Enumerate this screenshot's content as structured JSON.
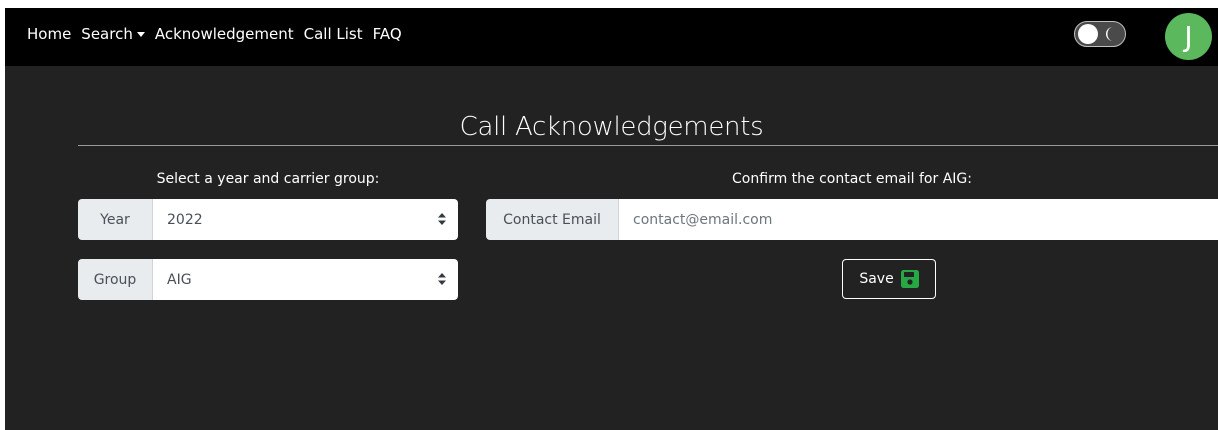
{
  "nav": {
    "items": [
      {
        "label": "Home"
      },
      {
        "label": "Search"
      },
      {
        "label": "Acknowledgement"
      },
      {
        "label": "Call List"
      },
      {
        "label": "FAQ"
      }
    ]
  },
  "theme_toggle": {
    "icon": "moon-icon",
    "state": "off"
  },
  "avatar": {
    "initial": "J",
    "color": "#5cb85c"
  },
  "page": {
    "title": "Call Acknowledgements"
  },
  "left_panel": {
    "heading": "Select a year and carrier group:",
    "year": {
      "label": "Year",
      "value": "2022"
    },
    "group": {
      "label": "Group",
      "value": "AIG"
    }
  },
  "right_panel": {
    "heading": "Confirm the contact email for AIG:",
    "email": {
      "label": "Contact Email",
      "value": "contact@email.com"
    },
    "save": {
      "label": "Save",
      "icon": "save-icon",
      "icon_color": "#28a745"
    }
  },
  "colors": {
    "background": "#222222",
    "navbar": "#000000",
    "accent_green": "#28a745"
  }
}
